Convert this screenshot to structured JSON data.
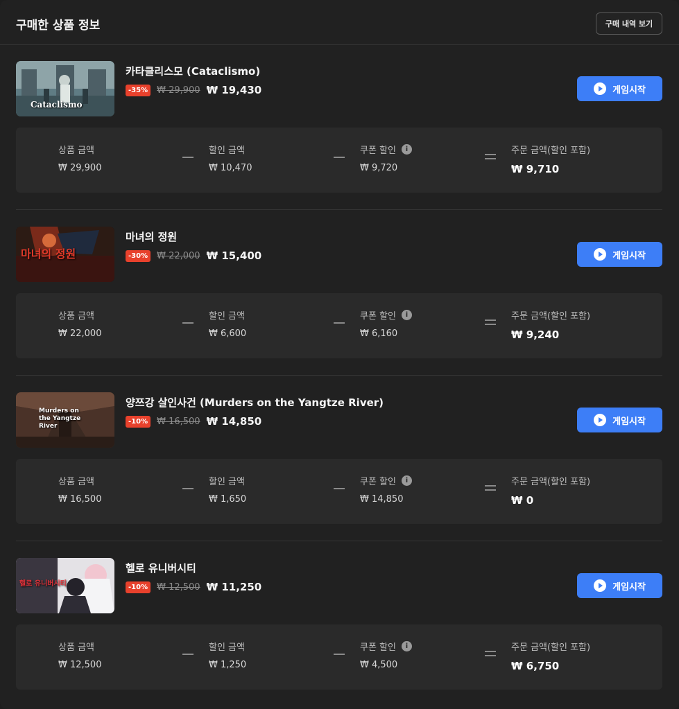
{
  "header": {
    "title": "구매한 상품 정보",
    "history_button": "구매 내역 보기"
  },
  "labels": {
    "product_amount": "상품 금액",
    "discount_amount": "할인 금액",
    "coupon_discount": "쿠폰 할인",
    "order_amount": "주문 금액(할인 포함)",
    "start_button": "게임시작"
  },
  "items": [
    {
      "title": "카타클리스모 (Cataclismo)",
      "thumb_text": "Cataclismo",
      "discount": "-35%",
      "original_price": "₩ 29,900",
      "sale_price": "₩ 19,430",
      "product_amount": "₩ 29,900",
      "discount_amount": "₩ 10,470",
      "coupon_discount": "₩ 9,720",
      "order_amount": "₩ 9,710"
    },
    {
      "title": "마녀의 정원",
      "thumb_text": "마녀의 정원",
      "discount": "-30%",
      "original_price": "₩ 22,000",
      "sale_price": "₩ 15,400",
      "product_amount": "₩ 22,000",
      "discount_amount": "₩ 6,600",
      "coupon_discount": "₩ 6,160",
      "order_amount": "₩ 9,240"
    },
    {
      "title": "양쯔강 살인사건 (Murders on the Yangtze River)",
      "thumb_text": "Murders on the Yangtze River",
      "discount": "-10%",
      "original_price": "₩ 16,500",
      "sale_price": "₩ 14,850",
      "product_amount": "₩ 16,500",
      "discount_amount": "₩ 1,650",
      "coupon_discount": "₩ 14,850",
      "order_amount": "₩ 0"
    },
    {
      "title": "헬로 유니버시티",
      "thumb_text": "헬로 유니버시티",
      "discount": "-10%",
      "original_price": "₩ 12,500",
      "sale_price": "₩ 11,250",
      "product_amount": "₩ 12,500",
      "discount_amount": "₩ 1,250",
      "coupon_discount": "₩ 4,500",
      "order_amount": "₩ 6,750"
    }
  ],
  "colors": {
    "accent": "#3d7ef7",
    "discount_badge": "#e8412c",
    "background": "#212121",
    "card": "#2a2a2a"
  }
}
